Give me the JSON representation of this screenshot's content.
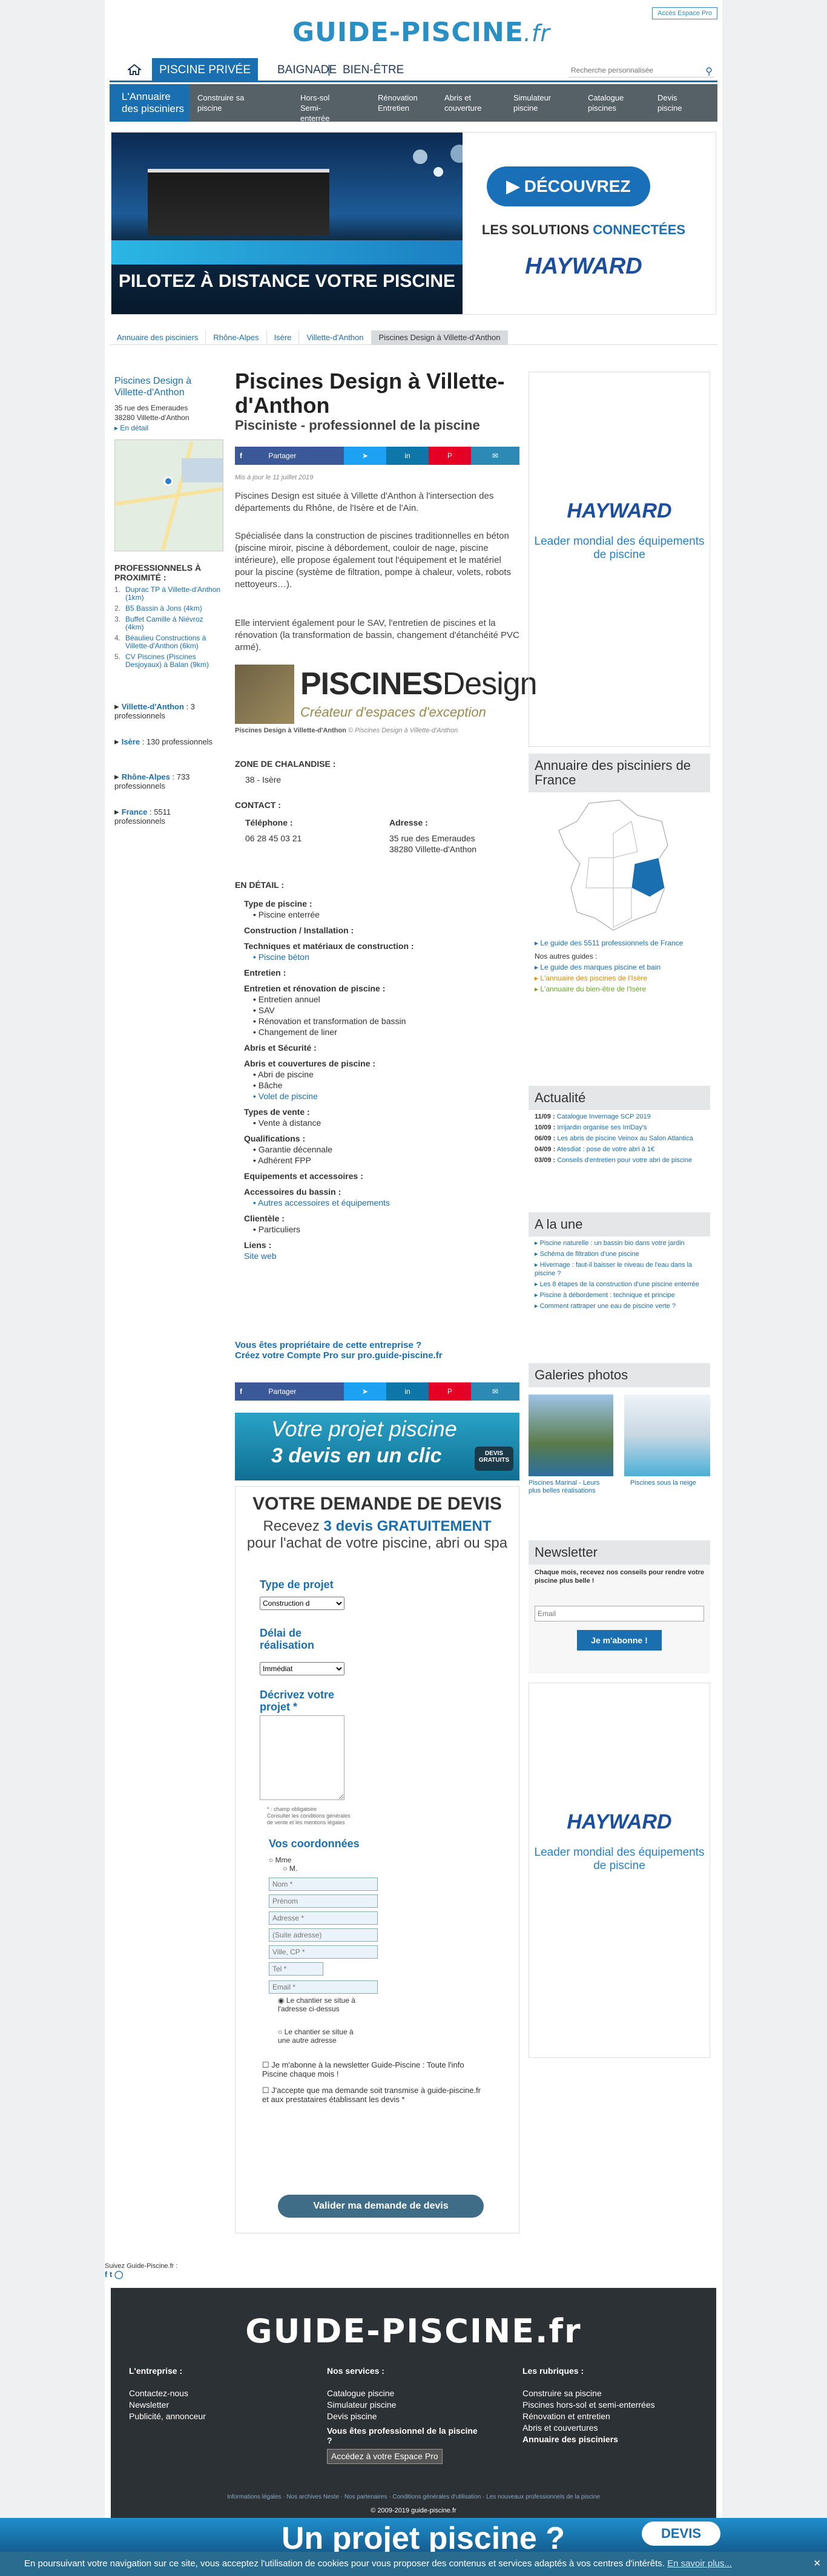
{
  "header": {
    "logo_main": "GUIDE-PISCINE",
    "logo_tld": ".fr",
    "espace_pro": "Accès Espace Pro",
    "search_placeholder": "Recherche personnalisée"
  },
  "topnav": {
    "tabs": [
      "PISCINE PRIVÉE",
      "BAIGNADE",
      "|",
      "BIEN-ÊTRE"
    ]
  },
  "subnav": {
    "first": "L'Annuaire des pisciniers",
    "items": [
      "Construire sa piscine",
      "Hors-sol Semi-enterrée",
      "Rénovation Entretien",
      "Abris et couverture",
      "Simulateur piscine",
      "Catalogue piscines",
      "Devis piscine"
    ]
  },
  "banner": {
    "pilot": "PILOTEZ À DISTANCE VOTRE PISCINE",
    "decouvrez": "DÉCOUVREZ",
    "solutions_a": "LES SOLUTIONS",
    "solutions_b": "CONNECTÉES",
    "brand": "HAYWARD"
  },
  "breadcrumb": [
    "Annuaire des pisciniers",
    "Rhône-Alpes",
    "Isère",
    "Villette-d'Anthon",
    "Piscines Design à Villette-d'Anthon"
  ],
  "left": {
    "name": "Piscines Design à Villette-d'Anthon",
    "addr1": "35 rue des Emeraudes",
    "addr2": "38280  Villette-d'Anthon",
    "detail_link": "▸ En détail",
    "prox_title": "PROFESSIONNELS À PROXIMITÉ :",
    "prox": [
      {
        "n": "1.",
        "t": "Duprac TP à Villette-d'Anthon (1km)"
      },
      {
        "n": "2.",
        "t": "B5 Bassin à Jons (4km)"
      },
      {
        "n": "3.",
        "t": "Buffet Camille à Niévroz (4km)"
      },
      {
        "n": "4.",
        "t": "Béaulieu Constructions à Villette-d'Anthon (6km)"
      },
      {
        "n": "5.",
        "t": "CV Piscines (Piscines Desjoyaux) à Balan (9km)"
      }
    ],
    "zones": [
      {
        "name": "Villette-d'Anthon",
        "count": ": 3 professionnels"
      },
      {
        "name": "Isère",
        "count": ": 130 professionnels"
      },
      {
        "name": "Rhône-Alpes",
        "count": ": 733 professionnels"
      },
      {
        "name": "France",
        "count": ": 5511 professionnels"
      }
    ]
  },
  "main": {
    "title": "Piscines Design à Villette-d'Anthon",
    "subtitle": "Pisciniste - professionnel de la piscine",
    "share": "Partager",
    "updated": "Mis à jour le 11 juillet 2019",
    "p1": "Piscines Design est située à Villette d'Anthon à l'intersection des départements du Rhône, de l'Isère et de l'Ain.",
    "p2": "Spécialisée dans la construction de piscines traditionnelles en béton (piscine miroir, piscine à débordement, couloir de nage, piscine intérieure), elle propose également tout l'équipement et le matériel pour la piscine (système de filtration, pompe à chaleur, volets, robots nettoyeurs…).",
    "p3": "Elle intervient également pour le SAV, l'entretien de piscines et la rénovation (la transformation de bassin, changement d'étanchéité PVC armé).",
    "logo_text": "PISCINES",
    "logo_text2": "Design",
    "logo_tagline": "Créateur d'espaces d'exception",
    "caption": "Piscines Design à Villette-d'Anthon",
    "caption_credit": "© Piscines Design à Villette-d'Anthon",
    "zone_title": "ZONE DE CHALANDISE :",
    "zone_value": "38 - Isère",
    "contact_title": "CONTACT :",
    "tel_label": "Téléphone :",
    "tel": "06 28 45 03 21",
    "adr_label": "Adresse :",
    "adr1": "35 rue des Emeraudes",
    "adr2": "38280  Villette-d'Anthon",
    "detail_title": "EN DÉTAIL :",
    "owner_q": "Vous êtes propriétaire de cette entreprise ?",
    "owner_cta": "Créez votre Compte Pro sur pro.guide-piscine.fr",
    "promo_a": "Votre projet piscine",
    "promo_b": "3 devis en un clic",
    "promo_badge": "DEVIS GRATUITS"
  },
  "details": [
    {
      "k": "h",
      "t": "Type de piscine :"
    },
    {
      "k": "i",
      "t": "Piscine enterrée"
    },
    {
      "k": "h",
      "t": "Construction / Installation :"
    },
    {
      "k": "h",
      "t": "Techniques et matériaux de construction :"
    },
    {
      "k": "l",
      "t": "Piscine béton"
    },
    {
      "k": "h",
      "t": "Entretien :"
    },
    {
      "k": "h",
      "t": "Entretien et rénovation de piscine :"
    },
    {
      "k": "i",
      "t": "Entretien annuel"
    },
    {
      "k": "i",
      "t": "SAV"
    },
    {
      "k": "i",
      "t": "Rénovation et transformation de bassin"
    },
    {
      "k": "i",
      "t": "Changement de liner"
    },
    {
      "k": "h",
      "t": "Abris et Sécurité :"
    },
    {
      "k": "h",
      "t": "Abris et couvertures de piscine :"
    },
    {
      "k": "i",
      "t": "Abri de piscine"
    },
    {
      "k": "i",
      "t": "Bâche"
    },
    {
      "k": "l",
      "t": "Volet de piscine"
    },
    {
      "k": "h",
      "t": "Types de vente :"
    },
    {
      "k": "i",
      "t": "Vente à distance"
    },
    {
      "k": "h",
      "t": "Qualifications :"
    },
    {
      "k": "i",
      "t": "Garantie décennale"
    },
    {
      "k": "i",
      "t": "Adhérent FPP"
    },
    {
      "k": "h",
      "t": "Equipements et accessoires :"
    },
    {
      "k": "h",
      "t": "Accessoires du bassin :"
    },
    {
      "k": "l",
      "t": "Autres accessoires et équipements"
    },
    {
      "k": "h",
      "t": "Clientèle :"
    },
    {
      "k": "i",
      "t": "Particuliers"
    },
    {
      "k": "h",
      "t": "Liens :"
    },
    {
      "k": "u",
      "t": "Site web"
    }
  ],
  "form": {
    "title": "VOTRE DEMANDE DE DEVIS",
    "sub_a": "Recevez",
    "sub_b": "3 devis",
    "sub_c": "GRATUITEMENT",
    "sub_d": "pour l'achat de votre piscine, abri ou spa",
    "type_label": "Type de projet",
    "type_value": "Construction d",
    "delai_label": "Délai de réalisation",
    "delai_value": "Immédiat",
    "desc_label": "Décrivez votre projet *",
    "required_note": "* : champ obligatoire",
    "cgu": "Consulter les conditions générales de vente et les mentions légales",
    "coords_label": "Vos coordonnées",
    "mme": "Mme",
    "m": "M.",
    "ph_nom": "Nom *",
    "ph_prenom": "Prénom",
    "ph_adresse": "Adresse *",
    "ph_suite": "(Suite adresse)",
    "ph_ville": "Ville, CP *",
    "ph_tel": "Tel *",
    "ph_email": "Email *",
    "chantier1": "Le chantier se situe à l'adresse ci-dessus",
    "chantier2": "Le chantier se situe à une autre adresse",
    "newsletter": "Je m'abonne à la newsletter Guide-Piscine : Toute l'info Piscine chaque mois !",
    "accept": "J'accepte que ma demande soit transmise à guide-piscine.fr et aux prestataires établissant les devis *",
    "submit": "Valider ma demande de devis"
  },
  "right": {
    "hay_brand": "HAYWARD",
    "hay_sub": "Leader mondial des équipements de piscine",
    "annuaire_title": "Annuaire des pisciniers de France",
    "guide_link": "▸ Le guide des 5511 professionnels de France",
    "other_title": "Nos autres guides :",
    "other": [
      "▸ Le guide des marques piscine et bain",
      "▸ L'annuaire des piscines de l'Isère",
      "▸ L'annuaire du bien-être de l'Isère"
    ],
    "actu_title": "Actualité",
    "actu": [
      {
        "d": "11/09 :",
        "t": "Catalogue Invernage SCP 2019"
      },
      {
        "d": "10/09 :",
        "t": "Irrijardin organise ses IrriDay's"
      },
      {
        "d": "06/09 :",
        "t": "Les abris de piscine Veinox au Salon Atlantica"
      },
      {
        "d": "04/09 :",
        "t": "Atesdiat : pose de votre abri à 1€"
      },
      {
        "d": "03/09 :",
        "t": "Conseils d'entretien pour votre abri de piscine"
      }
    ],
    "une_title": "A la une",
    "une": [
      "Piscine naturelle : un bassin bio dans votre jardin",
      "Schéma de filtration d'une piscine",
      "Hivernage : faut-il baisser le niveau de l'eau dans la piscine ?",
      "Les 8 étapes de la construction d'une piscine enterrée",
      "Piscine à débordement : technique et principe",
      "Comment rattraper une eau de piscine verte ?"
    ],
    "gal_title": "Galeries photos",
    "gal1": "Piscines Marinal - Leurs plus belles réalisations",
    "gal2": "Piscines sous la neige",
    "news_title": "Newsletter",
    "news_text": "Chaque mois, recevez nos conseils pour rendre votre piscine plus belle !",
    "news_ph": "Email",
    "news_btn": "Je m'abonne !"
  },
  "footer": {
    "follow": "Suivez Guide-Piscine.fr :",
    "logo": "GUIDE-PISCINE.fr",
    "col1_title": "L'entreprise :",
    "col1": [
      "Contactez-nous",
      "Newsletter",
      "Publicité, annonceur"
    ],
    "col2_title": "Nos services :",
    "col2": [
      "Catalogue piscine",
      "Simulateur piscine",
      "Devis piscine"
    ],
    "col2_pro": "Vous êtes professionnel de la piscine ?",
    "col2_btn": "Accédez à votre Espace Pro",
    "col3_title": "Les rubriques :",
    "col3": [
      "Construire sa piscine",
      "Piscines hors-sol et semi-enterrées",
      "Rénovation et entretien",
      "Abris et couvertures",
      "Annuaire des pisciniers"
    ],
    "legal": "Informations légales  ·  Nos archives Neste  ·  Nos partenaires  ·  Conditions générales d'utilisation  ·  Les nouveaux professionnels de la piscine",
    "copy": "© 2009-2019 guide-piscine.fr"
  },
  "bottom": {
    "proj": "Un projet piscine ?",
    "devis": "DEVIS"
  },
  "cookie": {
    "text": "En poursuivant votre navigation sur ce site, vous acceptez l'utilisation de cookies pour vous proposer des contenus et services adaptés à vos centres d'intérêts.",
    "link": "En savoir plus...",
    "close": "✕"
  }
}
